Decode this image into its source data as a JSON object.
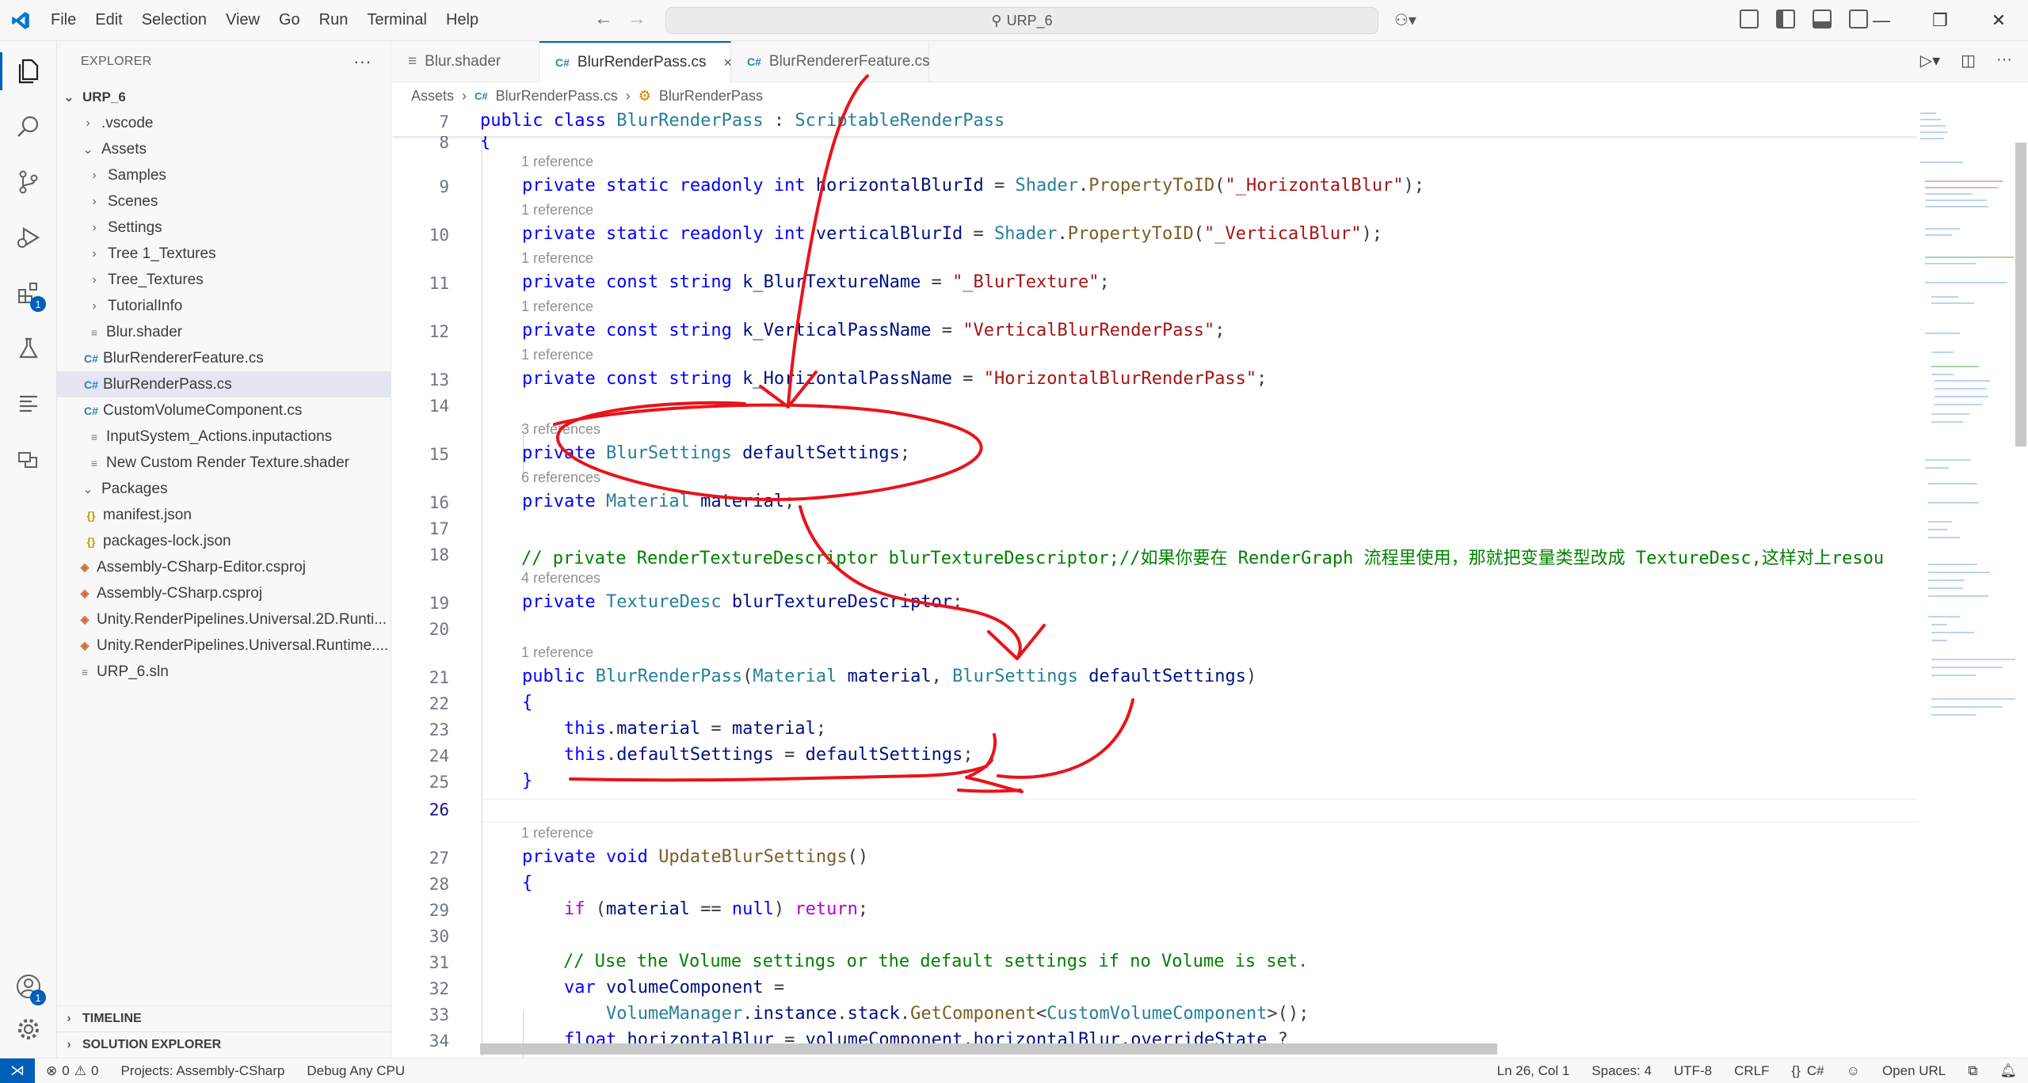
{
  "menu": [
    "File",
    "Edit",
    "Selection",
    "View",
    "Go",
    "Run",
    "Terminal",
    "Help"
  ],
  "search": {
    "text": "URP_6"
  },
  "sidebar": {
    "title": "EXPLORER",
    "more": "···",
    "root": "URP_6",
    "items": [
      {
        "label": ".vscode",
        "kind": "folder"
      },
      {
        "label": "Assets",
        "kind": "folder-open"
      },
      {
        "label": "Samples",
        "kind": "folder"
      },
      {
        "label": "Scenes",
        "kind": "folder"
      },
      {
        "label": "Settings",
        "kind": "folder"
      },
      {
        "label": "Tree 1_Textures",
        "kind": "folder"
      },
      {
        "label": "Tree_Textures",
        "kind": "folder"
      },
      {
        "label": "TutorialInfo",
        "kind": "folder"
      },
      {
        "label": "Blur.shader",
        "kind": "file"
      },
      {
        "label": "BlurRendererFeature.cs",
        "kind": "cs"
      },
      {
        "label": "BlurRenderPass.cs",
        "kind": "cs"
      },
      {
        "label": "CustomVolumeComponent.cs",
        "kind": "cs"
      },
      {
        "label": "InputSystem_Actions.inputactions",
        "kind": "file"
      },
      {
        "label": "New Custom Render Texture.shader",
        "kind": "file"
      },
      {
        "label": "Packages",
        "kind": "folder-open"
      },
      {
        "label": "manifest.json",
        "kind": "json"
      },
      {
        "label": "packages-lock.json",
        "kind": "json"
      },
      {
        "label": "Assembly-CSharp-Editor.csproj",
        "kind": "proj"
      },
      {
        "label": "Assembly-CSharp.csproj",
        "kind": "proj"
      },
      {
        "label": "Unity.RenderPipelines.Universal.2D.Runti...",
        "kind": "proj"
      },
      {
        "label": "Unity.RenderPipelines.Universal.Runtime....",
        "kind": "proj"
      },
      {
        "label": "URP_6.sln",
        "kind": "file"
      }
    ],
    "timeline": "TIMELINE",
    "solution_explorer": "SOLUTION EXPLORER"
  },
  "activity_badges": {
    "extensions": "1",
    "accounts": "1"
  },
  "tabs": [
    {
      "label": "Blur.shader",
      "icon": "≡"
    },
    {
      "label": "BlurRenderPass.cs",
      "icon": "C#"
    },
    {
      "label": "BlurRendererFeature.cs",
      "icon": "C#"
    }
  ],
  "tab_close": "×",
  "breadcrumb": [
    "Assets",
    "BlurRenderPass.cs",
    "BlurRenderPass"
  ],
  "sticky": {
    "num": "7",
    "text": "public class BlurRenderPass : ScriptableRenderPass"
  },
  "code": {
    "line8": "8",
    "l9": {
      "num": "9",
      "lens": "1 reference"
    },
    "l10": {
      "num": "10",
      "lens": "1 reference"
    },
    "l11": {
      "num": "11",
      "lens": "1 reference"
    },
    "l12": {
      "num": "12",
      "lens": "1 reference"
    },
    "l13": {
      "num": "13",
      "lens": "1 reference"
    },
    "l14": {
      "num": "14"
    },
    "l15": {
      "num": "15",
      "lens": "3 references"
    },
    "l16": {
      "num": "16",
      "lens": "6 references"
    },
    "l17": {
      "num": "17"
    },
    "l18": {
      "num": "18",
      "text": "// private RenderTextureDescriptor blurTextureDescriptor;//如果你要在 RenderGraph 流程里使用，那就把变量类型改成 TextureDesc,这样对上resou"
    },
    "l19": {
      "num": "19",
      "lens": "4 references"
    },
    "l20": {
      "num": "20"
    },
    "l21": {
      "num": "21",
      "lens": "1 reference"
    },
    "l22": {
      "num": "22"
    },
    "l23": {
      "num": "23"
    },
    "l24": {
      "num": "24"
    },
    "l25": {
      "num": "25"
    },
    "l26": {
      "num": "26"
    },
    "l27": {
      "num": "27",
      "lens": "1 reference"
    },
    "l28": {
      "num": "28"
    },
    "l29": {
      "num": "29"
    },
    "l30": {
      "num": "30"
    },
    "l31": {
      "num": "31",
      "text": "// Use the Volume settings or the default settings if no Volume is set."
    },
    "l32": {
      "num": "32"
    },
    "l33": {
      "num": "33"
    },
    "l34": {
      "num": "34"
    }
  },
  "status": {
    "errors": "0",
    "warnings": "0",
    "projects": "Projects: Assembly-CSharp",
    "debug": "Debug Any CPU",
    "position": "Ln 26, Col 1",
    "spaces": "Spaces: 4",
    "encoding": "UTF-8",
    "eol": "CRLF",
    "language": "C#",
    "open_url": "Open URL"
  },
  "colors": {
    "accent": "#005fb8",
    "annotation": "#e8141b"
  }
}
